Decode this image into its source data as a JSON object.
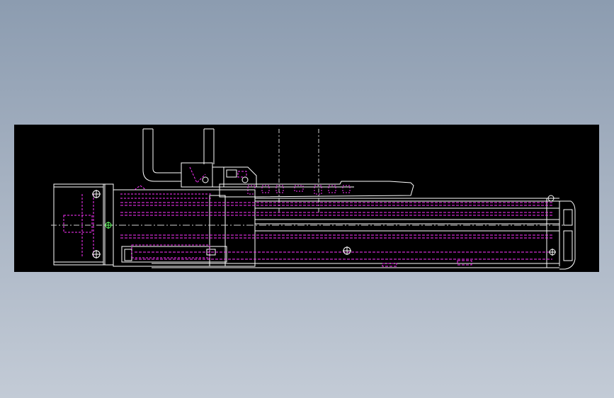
{
  "viewport": {
    "background": "#000000",
    "line_colors": {
      "outline": "#ffffff",
      "hidden": "#ff33ff",
      "center": "#cfcfcf",
      "accent": "#66ff66"
    }
  },
  "icons": {
    "bolt": "circle-cross",
    "motor_mount": "circle-cross",
    "carriage_screw": "circle-cross",
    "end_cap_bolt": "circle-cross"
  }
}
